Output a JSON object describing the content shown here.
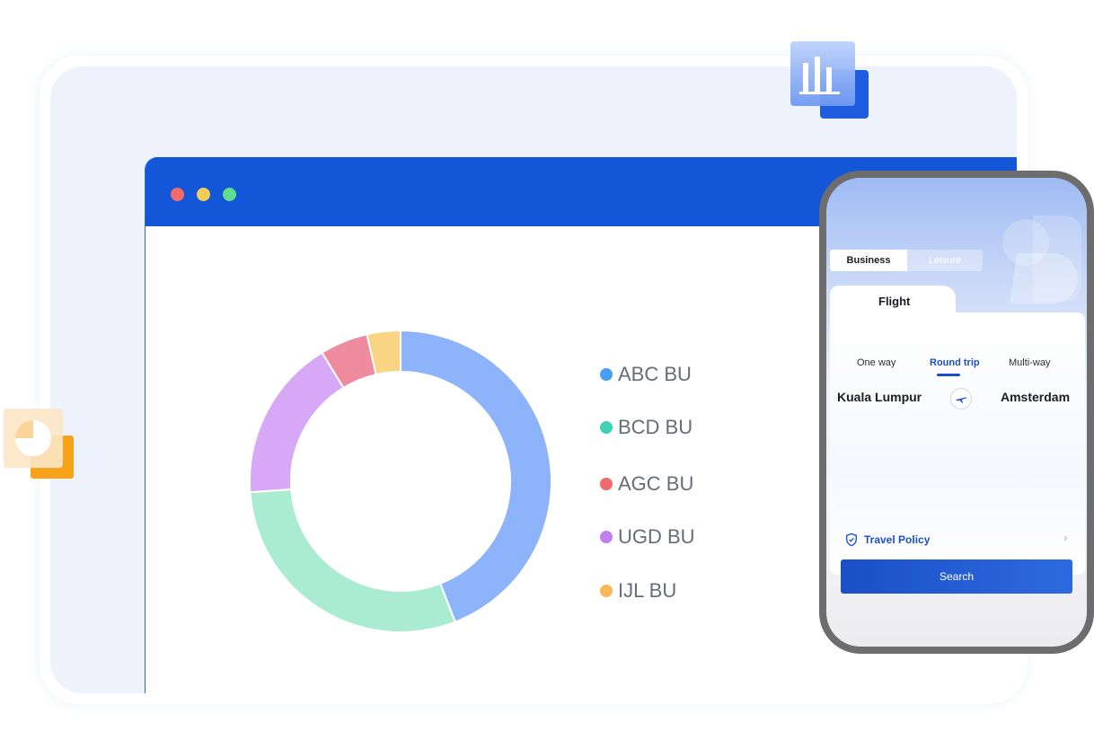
{
  "legend": {
    "items": [
      {
        "label": "ABC BU",
        "color": "#4a9ff0"
      },
      {
        "label": "BCD BU",
        "color": "#3fd3b4"
      },
      {
        "label": "AGC BU",
        "color": "#ee6b6b"
      },
      {
        "label": "UGD BU",
        "color": "#c27ff0"
      },
      {
        "label": "IJL BU",
        "color": "#f7b859"
      }
    ]
  },
  "chart_data": {
    "type": "pie",
    "categories": [
      "ABC BU",
      "BCD BU",
      "UGD BU",
      "AGC BU",
      "IJL BU"
    ],
    "values": [
      43,
      29,
      17,
      5,
      3.5
    ],
    "colors": [
      "#8db3fb",
      "#a9ecd2",
      "#d6a8f6",
      "#ef8b9e",
      "#f8d483"
    ],
    "donut": true
  },
  "window": {
    "dots": [
      "#f46b6b",
      "#f4cd59",
      "#5fdc8c"
    ]
  },
  "phone": {
    "tabs": {
      "business": "Business",
      "leisure": "Leisure"
    },
    "card_tab": "Flight",
    "trip_types": {
      "one_way": "One way",
      "round_trip": "Round trip",
      "multi_way": "Multi-way"
    },
    "from_city": "Kuala Lumpur",
    "to_city": "Amsterdam",
    "policy_label": "Travel Policy",
    "search_label": "Search"
  },
  "icons": {
    "bar_chart": "bar-chart-icon",
    "pie_chart": "pie-chart-icon",
    "swap": "airplane-icon",
    "shield": "shield-icon",
    "chevron": "chevron-right-icon"
  }
}
